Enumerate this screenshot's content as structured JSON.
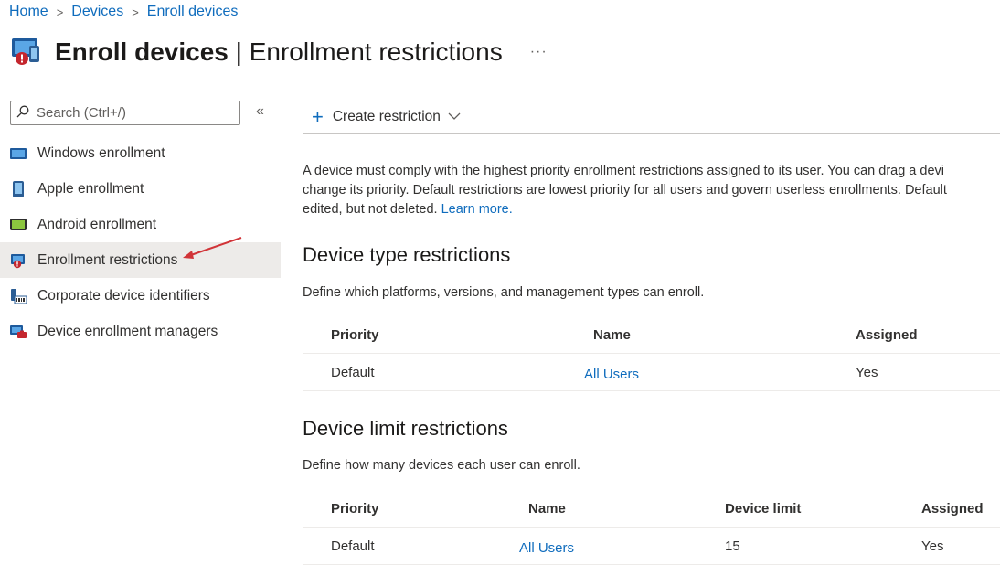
{
  "breadcrumb": [
    "Home",
    "Devices",
    "Enroll devices"
  ],
  "header": {
    "title_bold": "Enroll devices",
    "title_sep": " | ",
    "title_rest": "Enrollment restrictions",
    "more": "···"
  },
  "sidebar": {
    "search_placeholder": "Search (Ctrl+/)",
    "collapse": "«",
    "items": [
      {
        "label": "Windows enrollment",
        "icon": "windows-device-icon"
      },
      {
        "label": "Apple enrollment",
        "icon": "apple-phone-icon"
      },
      {
        "label": "Android enrollment",
        "icon": "android-tablet-icon"
      },
      {
        "label": "Enrollment restrictions",
        "icon": "restriction-icon",
        "active": true
      },
      {
        "label": "Corporate device identifiers",
        "icon": "barcode-device-icon"
      },
      {
        "label": "Device enrollment managers",
        "icon": "manager-device-icon"
      }
    ]
  },
  "toolbar": {
    "create_label": "Create restriction"
  },
  "main": {
    "description_line1": "A device must comply with the highest priority enrollment restrictions assigned to its user. You can drag a devi",
    "description_line2": "change its priority. Default restrictions are lowest priority for all users and govern userless enrollments. Default",
    "description_line3": "edited, but not deleted.",
    "learn_more": "Learn more.",
    "device_type": {
      "heading": "Device type restrictions",
      "subtitle": "Define which platforms, versions, and management types can enroll.",
      "columns": [
        "Priority",
        "Name",
        "Assigned"
      ],
      "rows": [
        [
          "Default",
          "All Users",
          "Yes"
        ]
      ]
    },
    "device_limit": {
      "heading": "Device limit restrictions",
      "subtitle": "Define how many devices each user can enroll.",
      "columns": [
        "Priority",
        "Name",
        "Device limit",
        "Assigned"
      ],
      "rows": [
        [
          "Default",
          "All Users",
          "15",
          "Yes"
        ]
      ]
    }
  },
  "colors": {
    "link": "#0f6cbd",
    "active_bg": "#edebe9",
    "annotation_arrow": "#d13438"
  }
}
